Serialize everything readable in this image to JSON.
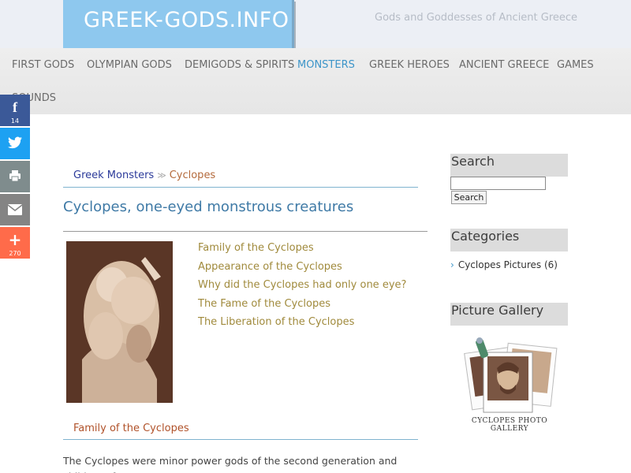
{
  "header": {
    "logo_text": "GREEK-GODS.INFO",
    "tagline": "Gods and Goddesses of Ancient Greece"
  },
  "nav": {
    "items": [
      {
        "label": "FIRST GODS"
      },
      {
        "label": "OLYMPIAN GODS"
      },
      {
        "label": "DEMIGODS & SPIRITS"
      },
      {
        "label": "MONSTERS",
        "active": true
      },
      {
        "label": "GREEK HEROES"
      },
      {
        "label": "ANCIENT GREECE"
      },
      {
        "label": "GAMES"
      },
      {
        "label": "SOUNDS"
      }
    ]
  },
  "social": {
    "facebook_count": "14",
    "plus_count": "270",
    "icons": [
      "facebook-icon",
      "twitter-icon",
      "print-icon",
      "email-icon",
      "plus-icon"
    ]
  },
  "breadcrumb": {
    "parent": "Greek Monsters",
    "separator": "≫",
    "current": "Cyclopes"
  },
  "article": {
    "title": "Cyclopes, one-eyed monstrous creatures",
    "toc": [
      "Family of the Cyclopes",
      "Appearance of the Cyclopes",
      "Why did the Cyclopes had only one eye?",
      "The Fame of the Cyclopes",
      "The Liberation of the Cyclopes"
    ],
    "section_heading": "Family of the Cyclopes",
    "body_text": "The Cyclopes were minor power gods of the second generation and children of"
  },
  "sidebar": {
    "search_heading": "Search",
    "search_value": "",
    "search_button": "Search",
    "categories_heading": "Categories",
    "category_item": "Cyclopes Pictures (6)",
    "gallery_heading": "Picture Gallery",
    "gallery_caption": "CYCLOPES PHOTO GALLERY"
  },
  "colors": {
    "logo_bg": "#8ec8ee",
    "nav_active": "#3d95c9",
    "title_blue": "#3f7aa6",
    "toc_gold": "#a08a3c"
  }
}
